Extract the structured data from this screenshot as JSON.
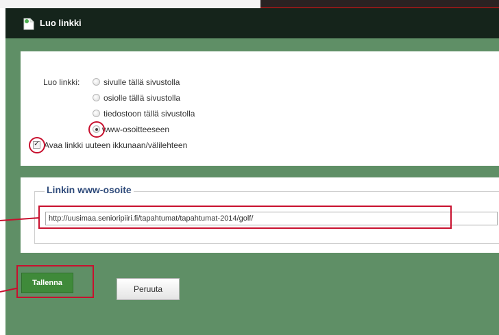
{
  "dialog": {
    "title": "Luo linkki",
    "accent_color": "#5f8f66",
    "icon": "document-link-icon"
  },
  "link_type": {
    "label": "Luo linkki:",
    "options": [
      {
        "label": "sivulle tällä sivustolla",
        "selected": false
      },
      {
        "label": "osiolle tällä sivustolla",
        "selected": false
      },
      {
        "label": "tiedostoon tällä sivustolla",
        "selected": false
      },
      {
        "label": "www-osoitteeseen",
        "selected": true
      }
    ]
  },
  "new_window": {
    "label": "Avaa linkki uuteen ikkunaan/välilehteen",
    "checked": true
  },
  "url_section": {
    "legend": "Linkin www-osoite",
    "value": "http://uusimaa.senioripiiri.fi/tapahtumat/tapahtumat-2014/golf/"
  },
  "buttons": {
    "save": "Tallenna",
    "cancel": "Peruuta"
  },
  "highlight_color": "#c8102e"
}
